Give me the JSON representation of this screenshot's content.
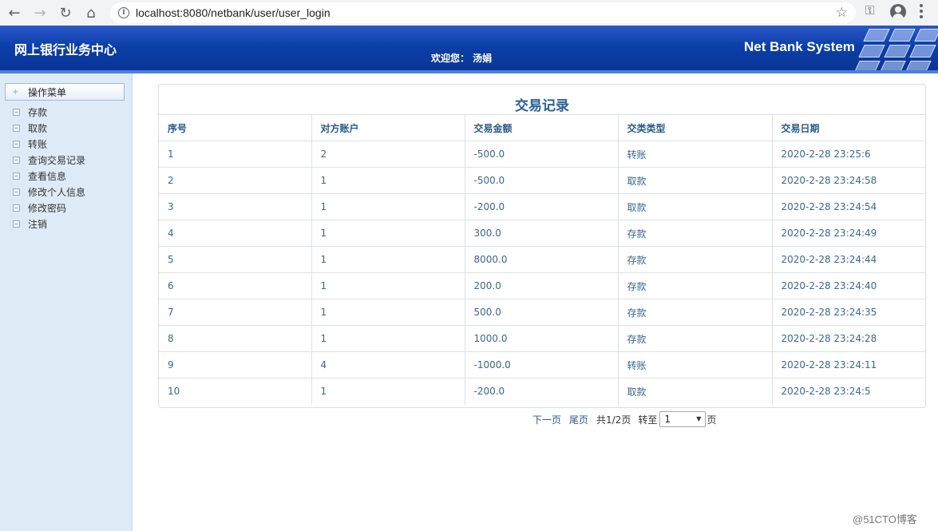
{
  "browser": {
    "url": "localhost:8080/netbank/user/user_login",
    "icons": [
      "back-arrow-icon",
      "forward-arrow-icon",
      "reload-icon",
      "home-icon",
      "info-icon",
      "star-icon",
      "key-icon",
      "account-icon",
      "menu-icon"
    ]
  },
  "header": {
    "title": "网上银行业务中心",
    "welcome": "欢迎您： 汤娟",
    "system_name": "Net Bank System"
  },
  "sidebar": {
    "header_label": "操作菜单",
    "items": [
      {
        "label": "存款"
      },
      {
        "label": "取款"
      },
      {
        "label": "转账"
      },
      {
        "label": "查询交易记录"
      },
      {
        "label": "查看信息"
      },
      {
        "label": "修改个人信息"
      },
      {
        "label": "修改密码"
      },
      {
        "label": "注销"
      }
    ]
  },
  "main": {
    "title": "交易记录",
    "columns": [
      "序号",
      "对方账户",
      "交易金额",
      "交类类型",
      "交易日期"
    ],
    "rows": [
      [
        "1",
        "2",
        "-500.0",
        "转账",
        "2020-2-28 23:25:6"
      ],
      [
        "2",
        "1",
        "-500.0",
        "取款",
        "2020-2-28 23:24:58"
      ],
      [
        "3",
        "1",
        "-200.0",
        "取款",
        "2020-2-28 23:24:54"
      ],
      [
        "4",
        "1",
        "300.0",
        "存款",
        "2020-2-28 23:24:49"
      ],
      [
        "5",
        "1",
        "8000.0",
        "存款",
        "2020-2-28 23:24:44"
      ],
      [
        "6",
        "1",
        "200.0",
        "存款",
        "2020-2-28 23:24:40"
      ],
      [
        "7",
        "1",
        "500.0",
        "存款",
        "2020-2-28 23:24:35"
      ],
      [
        "8",
        "1",
        "1000.0",
        "存款",
        "2020-2-28 23:24:28"
      ],
      [
        "9",
        "4",
        "-1000.0",
        "转账",
        "2020-2-28 23:24:11"
      ],
      [
        "10",
        "1",
        "-200.0",
        "取款",
        "2020-2-28 23:24:5"
      ]
    ]
  },
  "pager": {
    "next": "下一页",
    "last": "尾页",
    "total": "共1/2页",
    "goto": "转至",
    "selected": "1",
    "suffix": "页"
  },
  "watermark": "@51CTO博客"
}
